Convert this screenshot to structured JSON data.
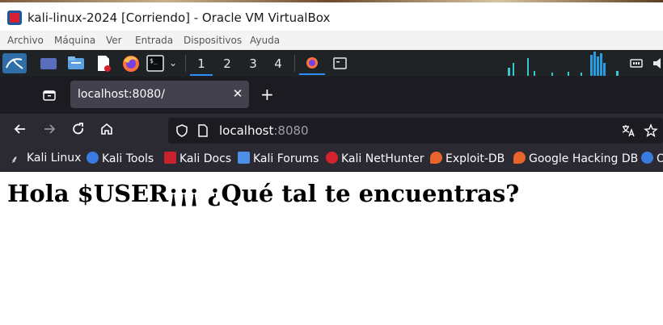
{
  "window": {
    "title": "kali-linux-2024 [Corriendo] - Oracle VM VirtualBox"
  },
  "vbox_menu": [
    "Archivo",
    "Máquina",
    "Ver",
    "Entrada",
    "Dispositivos",
    "Ayuda"
  ],
  "kali_panel": {
    "workspaces": [
      "1",
      "2",
      "3",
      "4"
    ],
    "active_workspace": "1",
    "launchers": [
      "kali-menu-icon",
      "desktop-icon",
      "file-manager-icon",
      "text-editor-icon",
      "firefox-icon",
      "terminal-icon"
    ]
  },
  "browser": {
    "tab": {
      "title": "localhost:8080/"
    },
    "url": {
      "host": "localhost",
      "port": ":8080"
    },
    "bookmarks": [
      "Kali Linux",
      "Kali Tools",
      "Kali Docs",
      "Kali Forums",
      "Kali NetHunter",
      "Exploit-DB",
      "Google Hacking DB",
      "O"
    ]
  },
  "page": {
    "heading": "Hola $USER¡¡¡ ¿Qué tal te encuentras?"
  }
}
